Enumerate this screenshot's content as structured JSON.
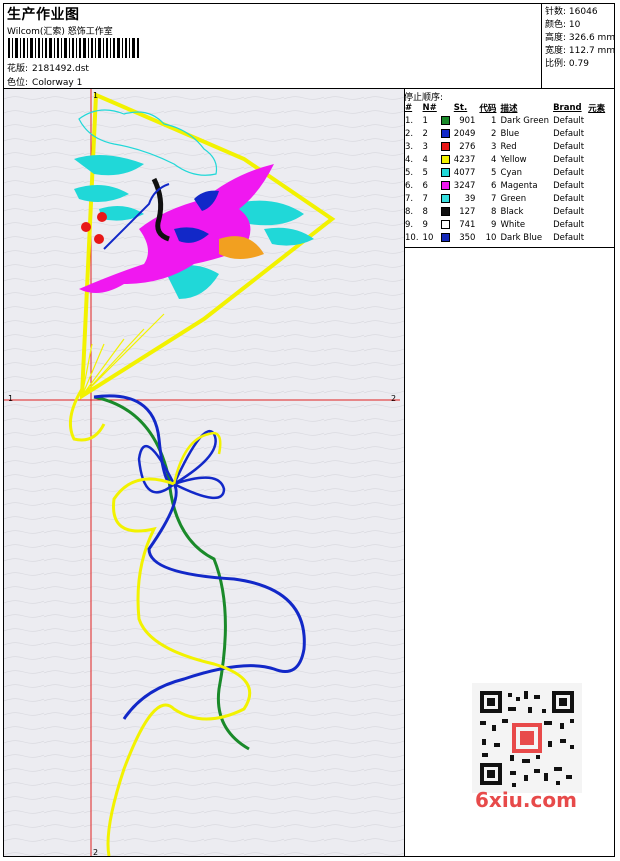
{
  "header": {
    "title": "生产作业图",
    "studio": "Wilcom(汇索) 怒饰工作室",
    "design_label": "花版:",
    "design_file": "2181492.dst",
    "colorway_label": "色位:",
    "colorway": "Colorway 1"
  },
  "stats": [
    {
      "label": "针数:",
      "value": "16046"
    },
    {
      "label": "颜色:",
      "value": "10"
    },
    {
      "label": "高度:",
      "value": "326.6 mm"
    },
    {
      "label": "宽度:",
      "value": "112.7 mm"
    },
    {
      "label": "比例:",
      "value": "0.79"
    }
  ],
  "color_sequence": {
    "title": "停止顺序:",
    "headers": [
      "#",
      "N#",
      "St.",
      "代码",
      "描述",
      "Brand",
      "元素"
    ],
    "rows": [
      {
        "idx": "1.",
        "n": "1",
        "color": "#1a8a2a",
        "st": "901",
        "code": "1",
        "desc": "Dark Green",
        "brand": "Default"
      },
      {
        "idx": "2.",
        "n": "2",
        "color": "#1228c8",
        "st": "2049",
        "code": "2",
        "desc": "Blue",
        "brand": "Default"
      },
      {
        "idx": "3.",
        "n": "3",
        "color": "#e81818",
        "st": "276",
        "code": "3",
        "desc": "Red",
        "brand": "Default"
      },
      {
        "idx": "4.",
        "n": "4",
        "color": "#f2f200",
        "st": "4237",
        "code": "4",
        "desc": "Yellow",
        "brand": "Default"
      },
      {
        "idx": "5.",
        "n": "5",
        "color": "#20d8d8",
        "st": "4077",
        "code": "5",
        "desc": "Cyan",
        "brand": "Default"
      },
      {
        "idx": "6.",
        "n": "6",
        "color": "#f018f0",
        "st": "3247",
        "code": "6",
        "desc": "Magenta",
        "brand": "Default"
      },
      {
        "idx": "7.",
        "n": "7",
        "color": "#38e0e0",
        "st": "39",
        "code": "7",
        "desc": "Green",
        "brand": "Default"
      },
      {
        "idx": "8.",
        "n": "8",
        "color": "#101010",
        "st": "127",
        "code": "8",
        "desc": "Black",
        "brand": "Default"
      },
      {
        "idx": "9.",
        "n": "9",
        "color": "#ffffff",
        "st": "741",
        "code": "9",
        "desc": "White",
        "brand": "Default"
      },
      {
        "idx": "10.",
        "n": "10",
        "color": "#1428b8",
        "st": "350",
        "code": "10",
        "desc": "Dark Blue",
        "brand": "Default"
      }
    ]
  },
  "axis": {
    "x_start": "1",
    "x_end": "2",
    "y_start": "1",
    "y_end": "2"
  },
  "watermark": "6xiu.com"
}
